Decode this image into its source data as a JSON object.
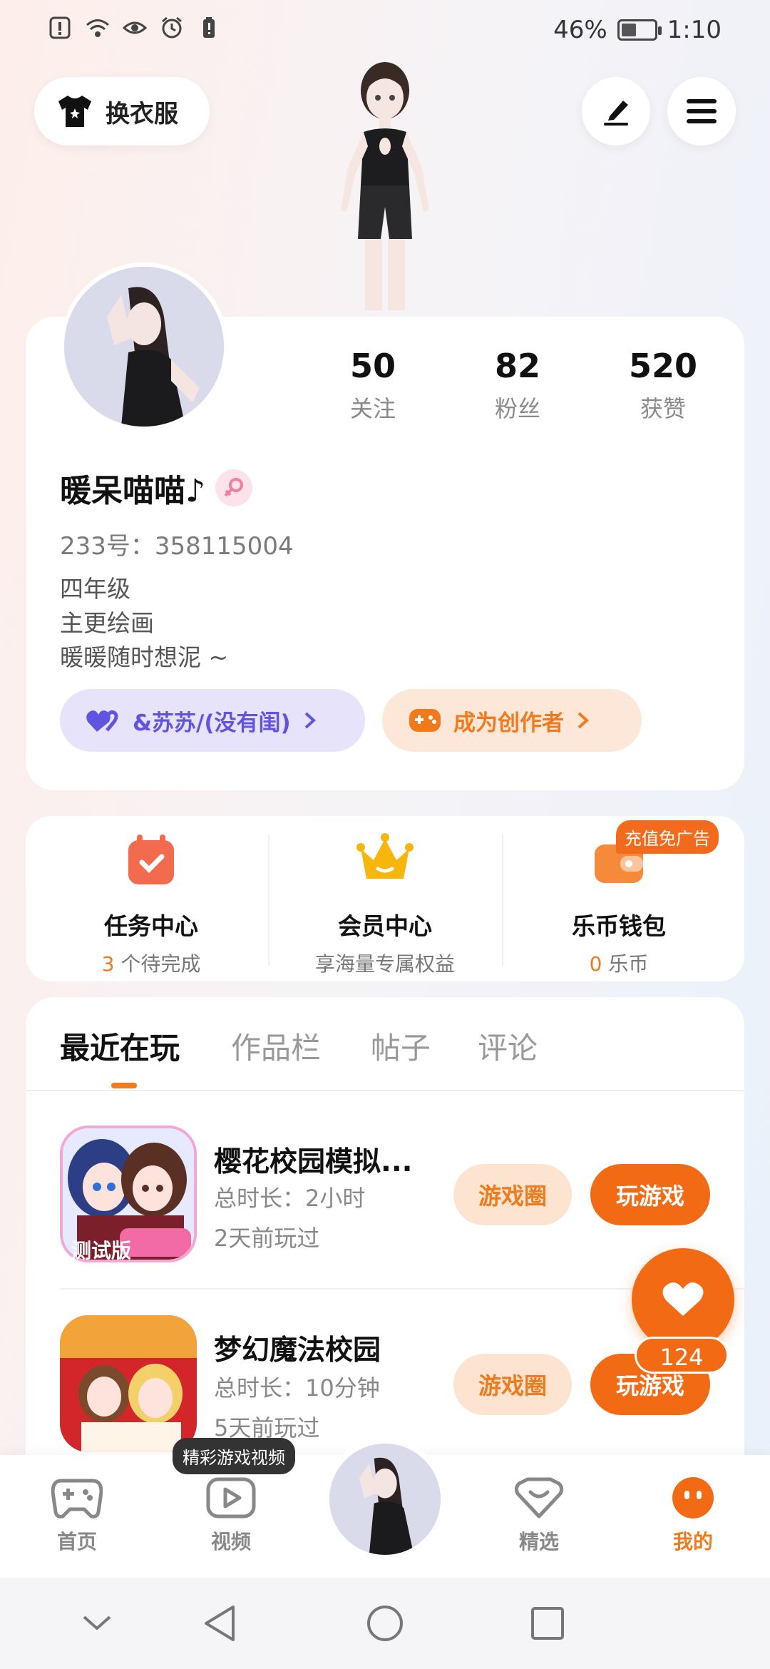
{
  "status_bar": {
    "battery": "46%",
    "time": "1:10",
    "battery_level": 0.46
  },
  "header": {
    "change_outfit_label": "换衣服"
  },
  "profile": {
    "following_count": "50",
    "following_label": "关注",
    "followers_count": "82",
    "followers_label": "粉丝",
    "likes_count": "520",
    "likes_label": "获赞",
    "nickname": "暖呆喵喵♪",
    "uid": "233号：358115004",
    "bio": [
      "四年级",
      "主更绘画",
      "暖暖随时想泥 ~"
    ],
    "friend_pill": "&苏苏/(没有闺)",
    "creator_pill": "成为创作者"
  },
  "services": {
    "tasks": {
      "title": "任务中心",
      "count": "3",
      "suffix": " 个待完成"
    },
    "vip": {
      "title": "会员中心",
      "subtitle": "享海量专属权益"
    },
    "wallet": {
      "title": "乐币钱包",
      "count": "0",
      "suffix": " 乐币",
      "badge": "充值免广告"
    }
  },
  "tabs": [
    "最近在玩",
    "作品栏",
    "帖子",
    "评论"
  ],
  "games": [
    {
      "title": "樱花校园模拟...",
      "duration": "总时长：2小时",
      "last_played": "2天前玩过",
      "circle_btn": "游戏圈",
      "play_btn": "玩游戏",
      "icon_badge": "测试版"
    },
    {
      "title": "梦幻魔法校园",
      "duration": "总时长：10分钟",
      "last_played": "5天前玩过",
      "circle_btn": "游戏圈",
      "play_btn": "玩游戏"
    }
  ],
  "fab": {
    "count": "124"
  },
  "bottom_nav": {
    "tooltip": "精彩游戏视频",
    "items": [
      "首页",
      "视频",
      "精选",
      "我的"
    ]
  },
  "colors": {
    "accent": "#f26a13",
    "friend": "#6354e0"
  }
}
